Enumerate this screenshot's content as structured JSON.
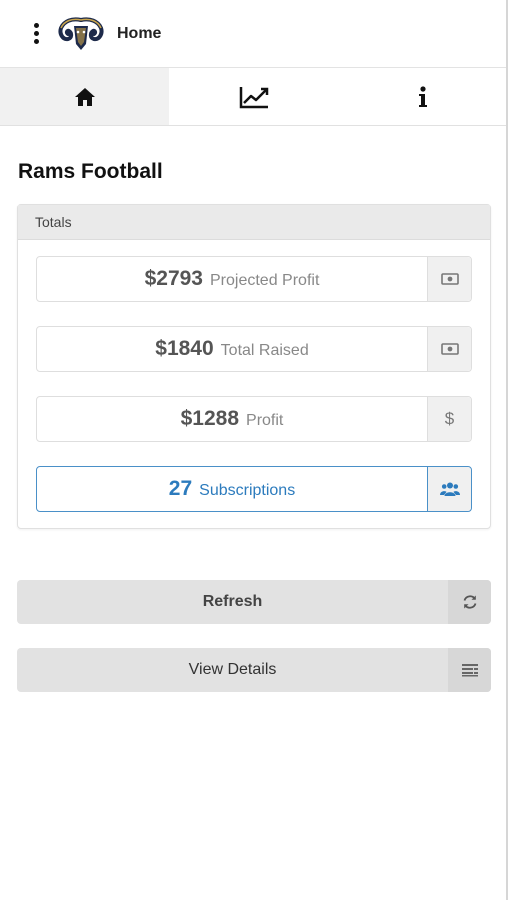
{
  "header": {
    "title": "Home",
    "logo_icon": "rams-logo-icon",
    "menu_icon": "kebab-menu-icon"
  },
  "tabs": [
    {
      "icon": "home-icon",
      "active": true
    },
    {
      "icon": "chart-line-icon",
      "active": false
    },
    {
      "icon": "info-icon",
      "active": false
    }
  ],
  "page": {
    "title": "Rams Football"
  },
  "totals": {
    "heading": "Totals",
    "stats": [
      {
        "value": "$2793",
        "label": "Projected Profit",
        "icon": "money-icon"
      },
      {
        "value": "$1840",
        "label": "Total Raised",
        "icon": "money-icon"
      },
      {
        "value": "$1288",
        "label": "Profit",
        "icon_text": "$"
      },
      {
        "value": "27",
        "label": "Subscriptions",
        "icon": "users-icon"
      }
    ]
  },
  "actions": {
    "refresh_label": "Refresh",
    "refresh_icon": "refresh-icon",
    "details_label": "View Details",
    "details_icon": "list-icon"
  },
  "colors": {
    "accent_blue": "#2c7bbd",
    "button_gray": "#e2e2e2",
    "tab_active_bg": "#f1f1f1"
  }
}
